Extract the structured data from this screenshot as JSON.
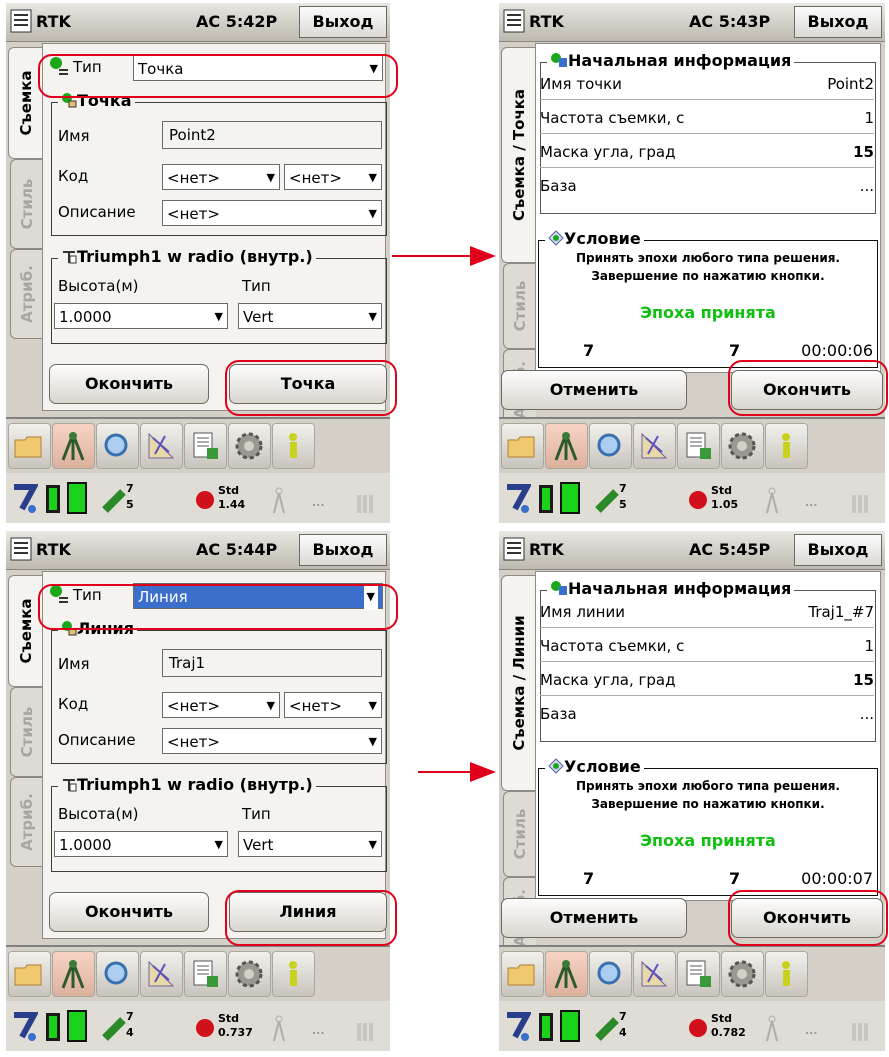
{
  "titlebar": {
    "app": "RTK",
    "exit": "Выход"
  },
  "clocks": [
    "AC  5:42P",
    "AC  5:43P",
    "AC  5:44P",
    "AC  5:45P"
  ],
  "tabs": {
    "survey": "Съемка",
    "style": "Стиль",
    "attr": "Атриб.",
    "survey_point": "Съемка / Точка",
    "survey_line": "Съемка / Линии"
  },
  "form1": {
    "type_label": "Тип",
    "type_value": "Точка",
    "group": "Точка",
    "name_label": "Имя",
    "name_value": "Point2",
    "code_label": "Код",
    "code_value1": "<нет>",
    "code_value2": "<нет>",
    "desc_label": "Описание",
    "desc_value": "<нет>",
    "antenna_group": "Triumph1 w radio (внутр.)",
    "height_label": "Высота(м)",
    "height_value": "1.0000",
    "htype_label": "Тип",
    "htype_value": "Vert",
    "finish_btn": "Окончить",
    "action_btn": "Точка"
  },
  "form2": {
    "type_label": "Тип",
    "type_value": "Линия",
    "group": "Линия",
    "name_label": "Имя",
    "name_value": "Traj1",
    "code_label": "Код",
    "code_value1": "<нет>",
    "code_value2": "<нет>",
    "desc_label": "Описание",
    "desc_value": "<нет>",
    "antenna_group": "Triumph1 w radio (внутр.)",
    "height_label": "Высота(м)",
    "height_value": "1.0000",
    "htype_label": "Тип",
    "htype_value": "Vert",
    "finish_btn": "Окончить",
    "action_btn": "Линия"
  },
  "info1": {
    "group": "Начальная информация",
    "rows": [
      {
        "label": "Имя точки",
        "value": "Point2"
      },
      {
        "label": "Частота съемки, с",
        "value": "1"
      },
      {
        "label": "Маска угла, град",
        "value": "15"
      },
      {
        "label": "База",
        "value": "..."
      }
    ],
    "condition": "Условие",
    "cond_line1": "Принять эпохи любого типа решения.",
    "cond_line2": "Завершение по нажатию кнопки.",
    "accepted": "Эпоха принята",
    "epoch_a": "7",
    "epoch_b": "7",
    "time": "00:00:06",
    "cancel_btn": "Отменить",
    "finish_btn": "Окончить"
  },
  "info2": {
    "group": "Начальная информация",
    "rows": [
      {
        "label": "Имя линии",
        "value": "Traj1_#7"
      },
      {
        "label": "Частота съемки, с",
        "value": "1"
      },
      {
        "label": "Маска угла, град",
        "value": "15"
      },
      {
        "label": "База",
        "value": "..."
      }
    ],
    "condition": "Условие",
    "cond_line1": "Принять эпохи любого типа решения.",
    "cond_line2": "Завершение по нажатию кнопки.",
    "accepted": "Эпоха принята",
    "epoch_a": "7",
    "epoch_b": "7",
    "time": "00:00:07",
    "cancel_btn": "Отменить",
    "finish_btn": "Окончить"
  },
  "status": [
    {
      "sats_top": "7",
      "sats_bot": "5",
      "std_label": "Std",
      "std_value": "1.44"
    },
    {
      "sats_top": "7",
      "sats_bot": "5",
      "std_label": "Std",
      "std_value": "1.05"
    },
    {
      "sats_top": "7",
      "sats_bot": "4",
      "std_label": "Std",
      "std_value": "0.737"
    },
    {
      "sats_top": "7",
      "sats_bot": "4",
      "std_label": "Std",
      "std_value": "0.782"
    }
  ],
  "status_dots": "...",
  "toolbar_icons": [
    "folder-icon",
    "surveyor-icon",
    "search-icon",
    "cogo-icon",
    "data-icon",
    "settings-icon",
    "info-icon"
  ],
  "colors": {
    "highlight": "#e0001b",
    "accepted": "#10c010",
    "selected": "#3b6fcb"
  }
}
